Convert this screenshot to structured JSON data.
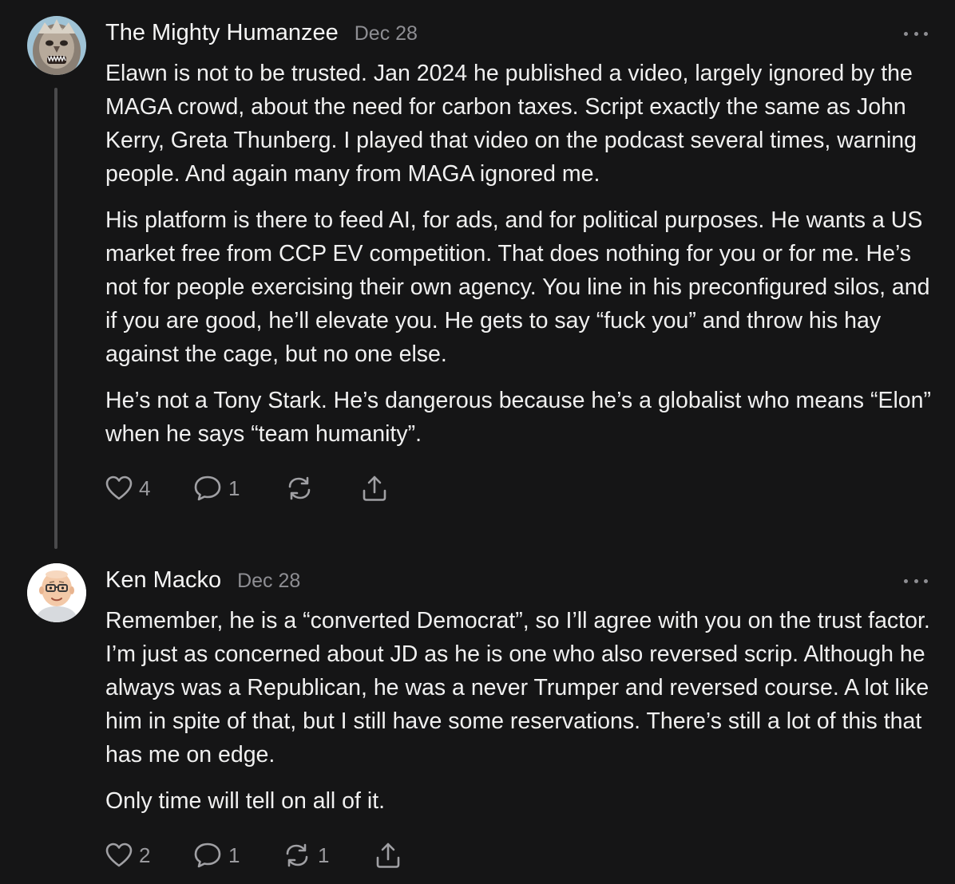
{
  "comments": [
    {
      "author": "The Mighty Humanzee",
      "date": "Dec 28",
      "avatar_icon": "bigfoot-avatar",
      "paragraphs": [
        "Elawn is not to be trusted. Jan 2024 he published a video, largely ignored by the MAGA crowd, about the need for carbon taxes. Script exactly the same as John Kerry, Greta Thunberg. I played that video on the podcast several times, warning people. And again many from MAGA ignored me.",
        "His platform is there to feed AI, for ads, and for political purposes. He wants a US market free from CCP EV competition. That does nothing for you or for me. He’s not for people exercising their own agency. You line in his preconfigured silos, and if you are good, he’ll elevate you. He gets to say “fuck you” and throw his hay against the cage, but no one else.",
        "He’s not a Tony Stark. He’s dangerous because he’s a globalist who means “Elon” when he says “team humanity”."
      ],
      "likes": "4",
      "replies": "1",
      "restacks": "",
      "icons": [
        "heart-icon",
        "comment-icon",
        "restack-icon",
        "share-icon"
      ]
    },
    {
      "author": "Ken Macko",
      "date": "Dec 28",
      "avatar_icon": "bald-man-glasses-avatar",
      "paragraphs": [
        "Remember, he is a “converted Democrat”, so I’ll agree with you on the trust factor. I’m just as concerned about JD as he is one who also reversed scrip. Although he always was a Republican, he was a never Trumper and reversed course. A lot like him in spite of that, but I still have some reservations. There’s still a lot of this that has me on edge.",
        "Only time will tell on all of it."
      ],
      "likes": "2",
      "replies": "1",
      "restacks": "1",
      "icons": [
        "heart-icon",
        "comment-icon",
        "restack-icon",
        "share-icon"
      ]
    }
  ],
  "colors": {
    "background": "#151516",
    "text": "#f0f0f0",
    "muted": "#8e8e93",
    "thread_line": "#4a4a4c"
  }
}
